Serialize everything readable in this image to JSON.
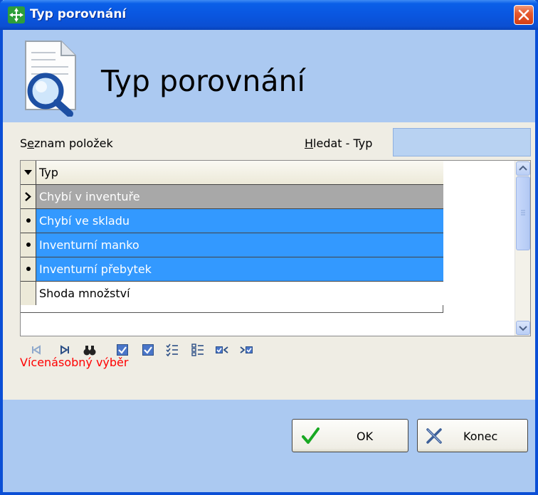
{
  "window": {
    "title": "Typ porovnání"
  },
  "header": {
    "title": "Typ porovnání"
  },
  "list": {
    "label": "Seznam položek"
  },
  "search": {
    "label": "Hledat - Typ",
    "value": ""
  },
  "grid": {
    "column_header": "Typ",
    "rows": [
      {
        "text": "Chybí v inventuře",
        "state": "current"
      },
      {
        "text": "Chybí ve skladu",
        "state": "selected"
      },
      {
        "text": "Inventurní manko",
        "state": "selected"
      },
      {
        "text": "Inventurní přebytek",
        "state": "selected"
      },
      {
        "text": "Shoda množství",
        "state": "normal"
      }
    ]
  },
  "multi_select": {
    "label": "Vícenásobný výběr"
  },
  "toolbar_icons": [
    "first-record-icon",
    "last-record-icon",
    "binoculars-icon",
    "check-icon",
    "check-all-icon",
    "list-check-icon",
    "list-uncheck-icon",
    "select-prev-icon",
    "select-next-icon"
  ],
  "buttons": {
    "ok": "OK",
    "close": "Konec"
  },
  "colors": {
    "title_bar": "#0a56e0",
    "selection": "#3399ff",
    "current_row": "#a8a8a8",
    "multi_label": "#ff0000"
  }
}
